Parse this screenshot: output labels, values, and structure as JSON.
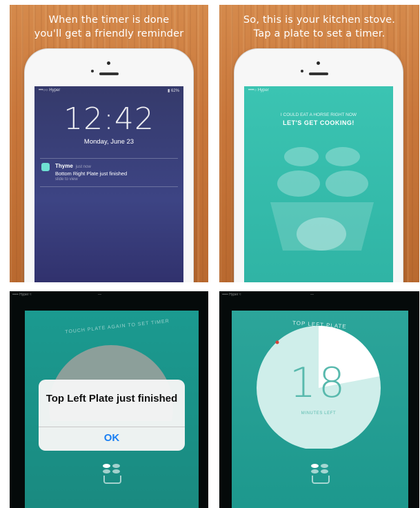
{
  "captions": {
    "panel1": [
      "When the timer is done",
      "you'll get a friendly reminder"
    ],
    "panel2": [
      "So, this is your kitchen stove.",
      "Tap a plate to set a timer."
    ]
  },
  "lock_screen": {
    "carrier": "•••○○ Hyper",
    "battery": "62%",
    "time": "12:42",
    "date": "Monday, June 23",
    "notification": {
      "app": "Thyme",
      "when": "just now",
      "body": "Bottom Right Plate just finished",
      "action": "slide to view"
    }
  },
  "stove_screen": {
    "status": "••••○ Hyper",
    "line1": "I COULD EAT A HORSE RIGHT NOW",
    "line2": "LET'S GET COOKING!"
  },
  "alert_screen": {
    "curved_text": "TOUCH PLATE AGAIN TO SET TIMER",
    "alert_title": "Top Left Plate just finished",
    "alert_button": "OK"
  },
  "timer_screen": {
    "plate_name": "TOP LEFT PLATE",
    "minutes": "18",
    "minutes_label": "MINUTES LEFT",
    "progress_remaining": 0.78
  },
  "colors": {
    "teal": "#1a9a8f",
    "lock_purple": "#3a3f78",
    "ios_blue": "#1a7ff3"
  }
}
